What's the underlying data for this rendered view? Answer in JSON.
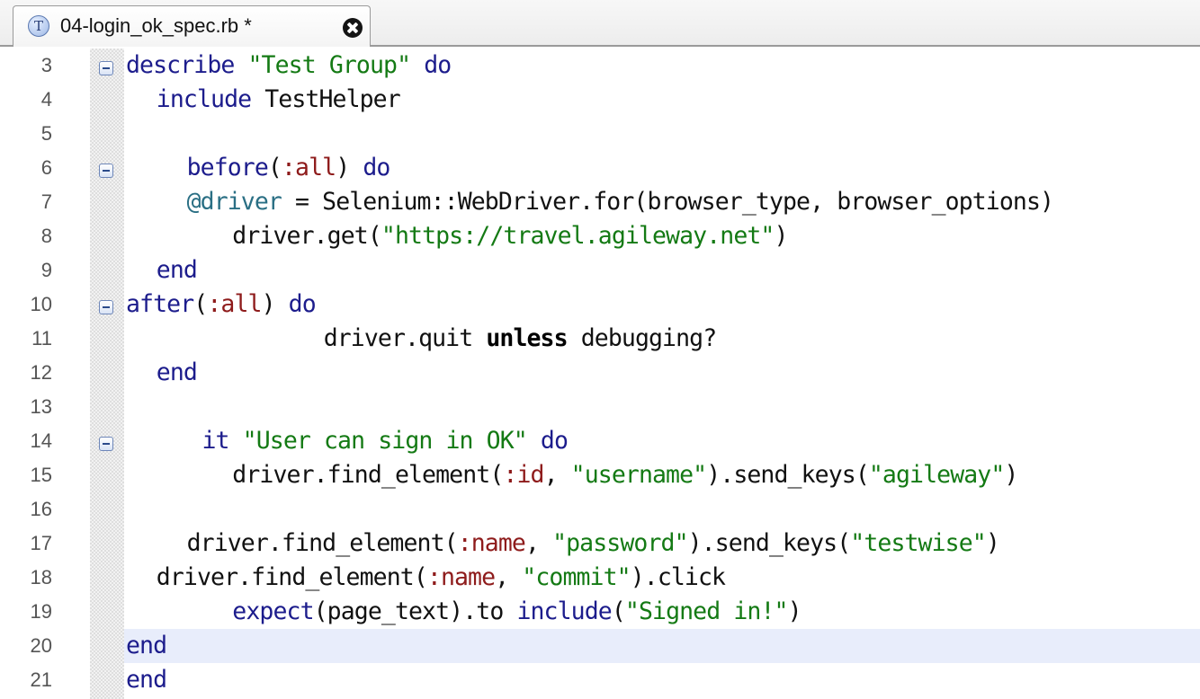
{
  "tab": {
    "title": "04-login_ok_spec.rb *",
    "icon": "ruby-test-file-icon",
    "icon_glyph": "T"
  },
  "editor": {
    "current_line": 20,
    "lines": [
      {
        "num": "3",
        "fold": true,
        "indent": 0,
        "tokens": [
          {
            "t": "kw",
            "v": "describe"
          },
          {
            "t": "plain",
            "v": " "
          },
          {
            "t": "str",
            "v": "\"Test Group\""
          },
          {
            "t": "plain",
            "v": " "
          },
          {
            "t": "kw",
            "v": "do"
          }
        ]
      },
      {
        "num": "4",
        "fold": false,
        "indent": 2,
        "tokens": [
          {
            "t": "kw",
            "v": "include"
          },
          {
            "t": "plain",
            "v": " TestHelper"
          }
        ]
      },
      {
        "num": "5",
        "fold": false,
        "indent": 0,
        "tokens": []
      },
      {
        "num": "6",
        "fold": true,
        "indent": 4,
        "tokens": [
          {
            "t": "kw",
            "v": "before"
          },
          {
            "t": "plain",
            "v": "("
          },
          {
            "t": "sym",
            "v": ":all"
          },
          {
            "t": "plain",
            "v": ") "
          },
          {
            "t": "kw",
            "v": "do"
          }
        ]
      },
      {
        "num": "7",
        "fold": false,
        "indent": 4,
        "tokens": [
          {
            "t": "ivar",
            "v": "@driver"
          },
          {
            "t": "plain",
            "v": " = Selenium::WebDriver.for(browser_type, browser_options)"
          }
        ]
      },
      {
        "num": "8",
        "fold": false,
        "indent": 7,
        "tokens": [
          {
            "t": "plain",
            "v": "driver.get("
          },
          {
            "t": "str",
            "v": "\"https://travel.agileway.net\""
          },
          {
            "t": "plain",
            "v": ")"
          }
        ]
      },
      {
        "num": "9",
        "fold": false,
        "indent": 2,
        "tokens": [
          {
            "t": "kw",
            "v": "end"
          }
        ]
      },
      {
        "num": "10",
        "fold": true,
        "indent": 0,
        "tokens": [
          {
            "t": "kw",
            "v": "after"
          },
          {
            "t": "plain",
            "v": "("
          },
          {
            "t": "sym",
            "v": ":all"
          },
          {
            "t": "plain",
            "v": ") "
          },
          {
            "t": "kw",
            "v": "do"
          }
        ]
      },
      {
        "num": "11",
        "fold": false,
        "indent": 13,
        "tokens": [
          {
            "t": "plain",
            "v": "driver.quit "
          },
          {
            "t": "kwb",
            "v": "unless"
          },
          {
            "t": "plain",
            "v": " debugging?"
          }
        ]
      },
      {
        "num": "12",
        "fold": false,
        "indent": 2,
        "tokens": [
          {
            "t": "kw",
            "v": "end"
          }
        ]
      },
      {
        "num": "13",
        "fold": false,
        "indent": 0,
        "tokens": []
      },
      {
        "num": "14",
        "fold": true,
        "indent": 5,
        "tokens": [
          {
            "t": "kw",
            "v": "it"
          },
          {
            "t": "plain",
            "v": " "
          },
          {
            "t": "str",
            "v": "\"User can sign in OK\""
          },
          {
            "t": "plain",
            "v": " "
          },
          {
            "t": "kw",
            "v": "do"
          }
        ]
      },
      {
        "num": "15",
        "fold": false,
        "indent": 7,
        "tokens": [
          {
            "t": "plain",
            "v": "driver.find_element("
          },
          {
            "t": "sym",
            "v": ":id"
          },
          {
            "t": "plain",
            "v": ", "
          },
          {
            "t": "str",
            "v": "\"username\""
          },
          {
            "t": "plain",
            "v": ").send_keys("
          },
          {
            "t": "str",
            "v": "\"agileway\""
          },
          {
            "t": "plain",
            "v": ")"
          }
        ]
      },
      {
        "num": "16",
        "fold": false,
        "indent": 0,
        "tokens": []
      },
      {
        "num": "17",
        "fold": false,
        "indent": 4,
        "tokens": [
          {
            "t": "plain",
            "v": "driver.find_element("
          },
          {
            "t": "sym",
            "v": ":name"
          },
          {
            "t": "plain",
            "v": ", "
          },
          {
            "t": "str",
            "v": "\"password\""
          },
          {
            "t": "plain",
            "v": ").send_keys("
          },
          {
            "t": "str",
            "v": "\"testwise\""
          },
          {
            "t": "plain",
            "v": ")"
          }
        ]
      },
      {
        "num": "18",
        "fold": false,
        "indent": 2,
        "tokens": [
          {
            "t": "plain",
            "v": "driver.find_element("
          },
          {
            "t": "sym",
            "v": ":name"
          },
          {
            "t": "plain",
            "v": ", "
          },
          {
            "t": "str",
            "v": "\"commit\""
          },
          {
            "t": "plain",
            "v": ").click"
          }
        ]
      },
      {
        "num": "19",
        "fold": false,
        "indent": 7,
        "tokens": [
          {
            "t": "kw",
            "v": "expect"
          },
          {
            "t": "plain",
            "v": "(page_text).to "
          },
          {
            "t": "kw",
            "v": "include"
          },
          {
            "t": "plain",
            "v": "("
          },
          {
            "t": "str",
            "v": "\"Signed in!\""
          },
          {
            "t": "plain",
            "v": ")"
          }
        ]
      },
      {
        "num": "20",
        "fold": false,
        "indent": 0,
        "tokens": [
          {
            "t": "kw",
            "v": "end"
          }
        ]
      },
      {
        "num": "21",
        "fold": false,
        "indent": 0,
        "tokens": [
          {
            "t": "kw",
            "v": "end"
          }
        ]
      }
    ]
  },
  "colors": {
    "keyword": "#1c1c8c",
    "string": "#147a14",
    "symbol": "#8e1b1b",
    "instance_variable": "#2a6f84",
    "current_line_highlight": "#e8edfb"
  }
}
